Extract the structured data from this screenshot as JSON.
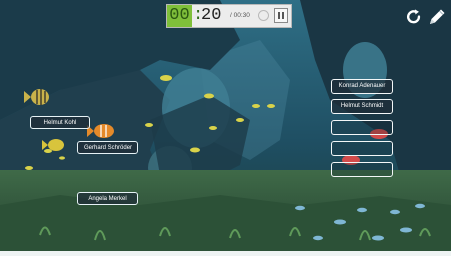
{
  "timer": {
    "minutes": "00",
    "separator": ":",
    "seconds": "20",
    "limit": "/ 00:30"
  },
  "toolbar": {
    "reset_icon": "refresh-icon",
    "edit_icon": "pencil-icon"
  },
  "draggable_names": [
    "Helmut Kohl",
    "Gerhard Schröder",
    "Angela Merkel"
  ],
  "answer_slots": [
    "Konrad Adenauer",
    "Helmut Schmidt",
    "",
    "",
    ""
  ],
  "colors": {
    "timer_accent": "#7fbf3a",
    "card_bg": "#1e2d37",
    "card_border": "#e6f2f6"
  }
}
